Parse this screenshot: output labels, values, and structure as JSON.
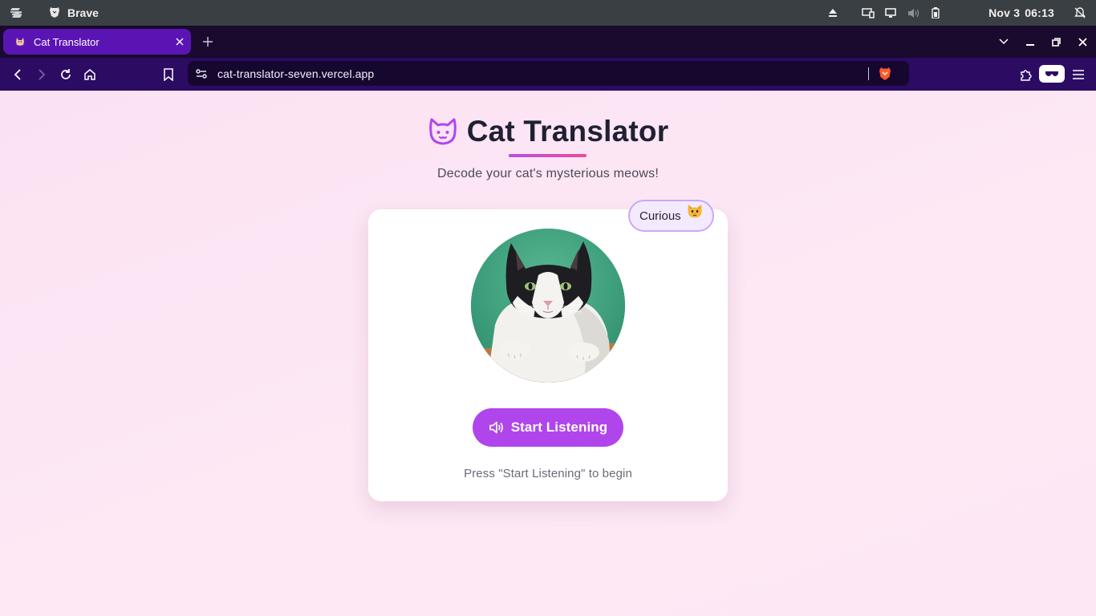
{
  "os": {
    "app_name": "Brave",
    "date": "Nov 3",
    "time": "06:13",
    "icons": [
      "zorin-logo-icon",
      "brave-lion-icon",
      "eject-icon",
      "display-icon",
      "screen-icon",
      "volume-muted-icon",
      "battery-icon",
      "notifications-off-icon"
    ]
  },
  "browser": {
    "tab": {
      "title": "Cat Translator",
      "favicon": "cat-favicon-icon"
    },
    "url": "cat-translator-seven.vercel.app",
    "accent": "#5b14b4"
  },
  "page": {
    "title": "Cat Translator",
    "subtitle": "Decode your cat's mysterious meows!",
    "mood": {
      "label": "Curious",
      "emoji": "🐱"
    },
    "listen_button": "Start Listening",
    "hint": "Press \"Start Listening\" to begin",
    "colors": {
      "brand_purple": "#b145ec",
      "title_text": "#1f2033",
      "background": "#fde7f4"
    }
  }
}
